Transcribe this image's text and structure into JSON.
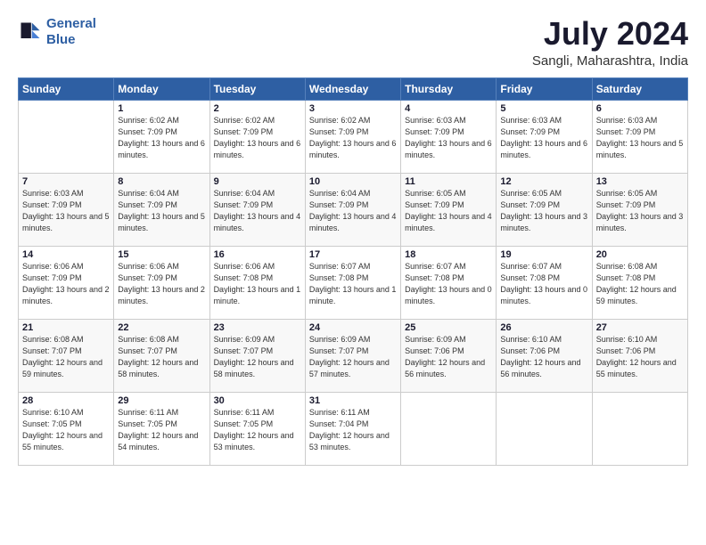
{
  "logo": {
    "line1": "General",
    "line2": "Blue"
  },
  "title": "July 2024",
  "subtitle": "Sangli, Maharashtra, India",
  "header_days": [
    "Sunday",
    "Monday",
    "Tuesday",
    "Wednesday",
    "Thursday",
    "Friday",
    "Saturday"
  ],
  "weeks": [
    [
      {
        "num": "",
        "sunrise": "",
        "sunset": "",
        "daylight": ""
      },
      {
        "num": "1",
        "sunrise": "Sunrise: 6:02 AM",
        "sunset": "Sunset: 7:09 PM",
        "daylight": "Daylight: 13 hours and 6 minutes."
      },
      {
        "num": "2",
        "sunrise": "Sunrise: 6:02 AM",
        "sunset": "Sunset: 7:09 PM",
        "daylight": "Daylight: 13 hours and 6 minutes."
      },
      {
        "num": "3",
        "sunrise": "Sunrise: 6:02 AM",
        "sunset": "Sunset: 7:09 PM",
        "daylight": "Daylight: 13 hours and 6 minutes."
      },
      {
        "num": "4",
        "sunrise": "Sunrise: 6:03 AM",
        "sunset": "Sunset: 7:09 PM",
        "daylight": "Daylight: 13 hours and 6 minutes."
      },
      {
        "num": "5",
        "sunrise": "Sunrise: 6:03 AM",
        "sunset": "Sunset: 7:09 PM",
        "daylight": "Daylight: 13 hours and 6 minutes."
      },
      {
        "num": "6",
        "sunrise": "Sunrise: 6:03 AM",
        "sunset": "Sunset: 7:09 PM",
        "daylight": "Daylight: 13 hours and 5 minutes."
      }
    ],
    [
      {
        "num": "7",
        "sunrise": "Sunrise: 6:03 AM",
        "sunset": "Sunset: 7:09 PM",
        "daylight": "Daylight: 13 hours and 5 minutes."
      },
      {
        "num": "8",
        "sunrise": "Sunrise: 6:04 AM",
        "sunset": "Sunset: 7:09 PM",
        "daylight": "Daylight: 13 hours and 5 minutes."
      },
      {
        "num": "9",
        "sunrise": "Sunrise: 6:04 AM",
        "sunset": "Sunset: 7:09 PM",
        "daylight": "Daylight: 13 hours and 4 minutes."
      },
      {
        "num": "10",
        "sunrise": "Sunrise: 6:04 AM",
        "sunset": "Sunset: 7:09 PM",
        "daylight": "Daylight: 13 hours and 4 minutes."
      },
      {
        "num": "11",
        "sunrise": "Sunrise: 6:05 AM",
        "sunset": "Sunset: 7:09 PM",
        "daylight": "Daylight: 13 hours and 4 minutes."
      },
      {
        "num": "12",
        "sunrise": "Sunrise: 6:05 AM",
        "sunset": "Sunset: 7:09 PM",
        "daylight": "Daylight: 13 hours and 3 minutes."
      },
      {
        "num": "13",
        "sunrise": "Sunrise: 6:05 AM",
        "sunset": "Sunset: 7:09 PM",
        "daylight": "Daylight: 13 hours and 3 minutes."
      }
    ],
    [
      {
        "num": "14",
        "sunrise": "Sunrise: 6:06 AM",
        "sunset": "Sunset: 7:09 PM",
        "daylight": "Daylight: 13 hours and 2 minutes."
      },
      {
        "num": "15",
        "sunrise": "Sunrise: 6:06 AM",
        "sunset": "Sunset: 7:09 PM",
        "daylight": "Daylight: 13 hours and 2 minutes."
      },
      {
        "num": "16",
        "sunrise": "Sunrise: 6:06 AM",
        "sunset": "Sunset: 7:08 PM",
        "daylight": "Daylight: 13 hours and 1 minute."
      },
      {
        "num": "17",
        "sunrise": "Sunrise: 6:07 AM",
        "sunset": "Sunset: 7:08 PM",
        "daylight": "Daylight: 13 hours and 1 minute."
      },
      {
        "num": "18",
        "sunrise": "Sunrise: 6:07 AM",
        "sunset": "Sunset: 7:08 PM",
        "daylight": "Daylight: 13 hours and 0 minutes."
      },
      {
        "num": "19",
        "sunrise": "Sunrise: 6:07 AM",
        "sunset": "Sunset: 7:08 PM",
        "daylight": "Daylight: 13 hours and 0 minutes."
      },
      {
        "num": "20",
        "sunrise": "Sunrise: 6:08 AM",
        "sunset": "Sunset: 7:08 PM",
        "daylight": "Daylight: 12 hours and 59 minutes."
      }
    ],
    [
      {
        "num": "21",
        "sunrise": "Sunrise: 6:08 AM",
        "sunset": "Sunset: 7:07 PM",
        "daylight": "Daylight: 12 hours and 59 minutes."
      },
      {
        "num": "22",
        "sunrise": "Sunrise: 6:08 AM",
        "sunset": "Sunset: 7:07 PM",
        "daylight": "Daylight: 12 hours and 58 minutes."
      },
      {
        "num": "23",
        "sunrise": "Sunrise: 6:09 AM",
        "sunset": "Sunset: 7:07 PM",
        "daylight": "Daylight: 12 hours and 58 minutes."
      },
      {
        "num": "24",
        "sunrise": "Sunrise: 6:09 AM",
        "sunset": "Sunset: 7:07 PM",
        "daylight": "Daylight: 12 hours and 57 minutes."
      },
      {
        "num": "25",
        "sunrise": "Sunrise: 6:09 AM",
        "sunset": "Sunset: 7:06 PM",
        "daylight": "Daylight: 12 hours and 56 minutes."
      },
      {
        "num": "26",
        "sunrise": "Sunrise: 6:10 AM",
        "sunset": "Sunset: 7:06 PM",
        "daylight": "Daylight: 12 hours and 56 minutes."
      },
      {
        "num": "27",
        "sunrise": "Sunrise: 6:10 AM",
        "sunset": "Sunset: 7:06 PM",
        "daylight": "Daylight: 12 hours and 55 minutes."
      }
    ],
    [
      {
        "num": "28",
        "sunrise": "Sunrise: 6:10 AM",
        "sunset": "Sunset: 7:05 PM",
        "daylight": "Daylight: 12 hours and 55 minutes."
      },
      {
        "num": "29",
        "sunrise": "Sunrise: 6:11 AM",
        "sunset": "Sunset: 7:05 PM",
        "daylight": "Daylight: 12 hours and 54 minutes."
      },
      {
        "num": "30",
        "sunrise": "Sunrise: 6:11 AM",
        "sunset": "Sunset: 7:05 PM",
        "daylight": "Daylight: 12 hours and 53 minutes."
      },
      {
        "num": "31",
        "sunrise": "Sunrise: 6:11 AM",
        "sunset": "Sunset: 7:04 PM",
        "daylight": "Daylight: 12 hours and 53 minutes."
      },
      {
        "num": "",
        "sunrise": "",
        "sunset": "",
        "daylight": ""
      },
      {
        "num": "",
        "sunrise": "",
        "sunset": "",
        "daylight": ""
      },
      {
        "num": "",
        "sunrise": "",
        "sunset": "",
        "daylight": ""
      }
    ]
  ]
}
